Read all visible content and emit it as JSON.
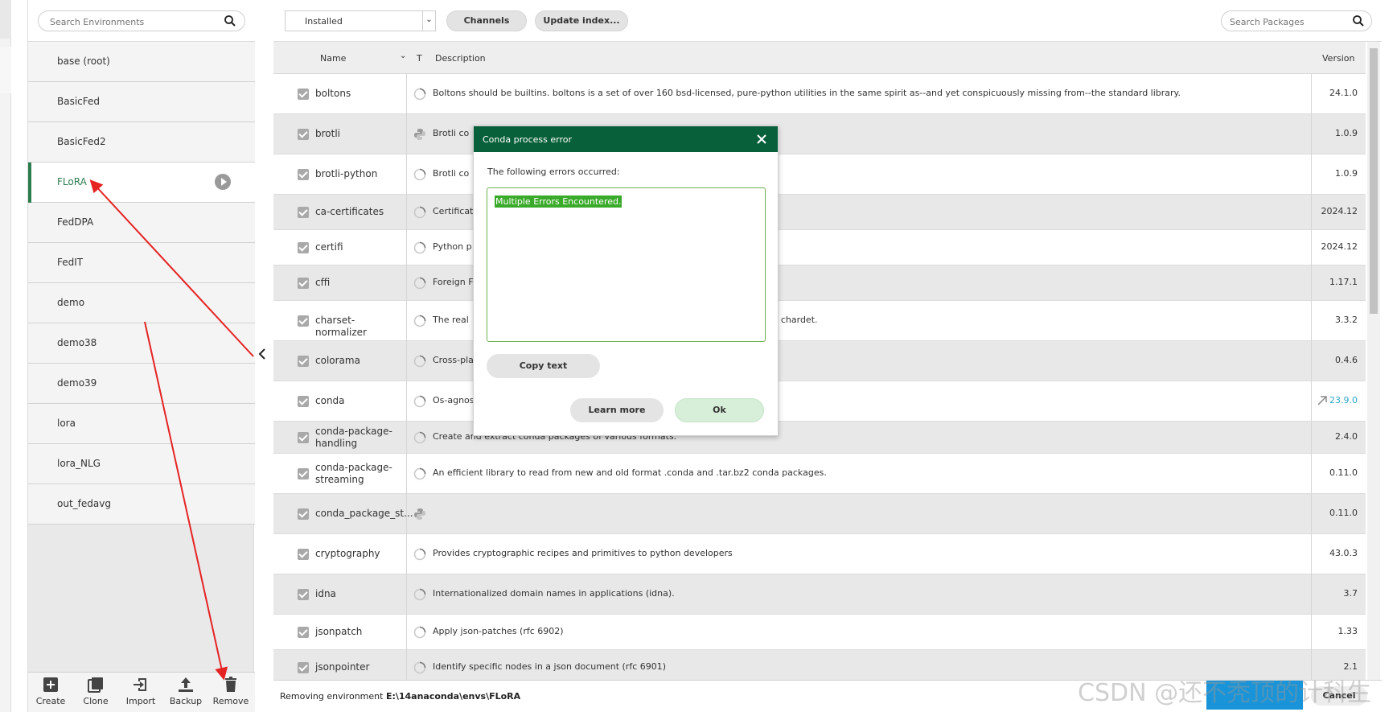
{
  "environments": {
    "search_placeholder": "Search Environments",
    "items": [
      {
        "label": "base (root)",
        "active": false
      },
      {
        "label": "BasicFed",
        "active": false
      },
      {
        "label": "BasicFed2",
        "active": false
      },
      {
        "label": "FLoRA",
        "active": true
      },
      {
        "label": "FedDPA",
        "active": false
      },
      {
        "label": "FedIT",
        "active": false
      },
      {
        "label": "demo",
        "active": false
      },
      {
        "label": "demo38",
        "active": false
      },
      {
        "label": "demo39",
        "active": false
      },
      {
        "label": "lora",
        "active": false
      },
      {
        "label": "lora_NLG",
        "active": false
      },
      {
        "label": "out_fedavg",
        "active": false
      }
    ],
    "toolbar": {
      "create": "Create",
      "clone": "Clone",
      "import": "Import",
      "backup": "Backup",
      "remove": "Remove"
    }
  },
  "packages": {
    "filter_value": "Installed",
    "channels_label": "Channels",
    "update_index_label": "Update index...",
    "search_placeholder": "Search Packages",
    "columns": {
      "name": "Name",
      "type": "T",
      "description": "Description",
      "version": "Version"
    },
    "rows": [
      {
        "name": "boltons",
        "description": "Boltons should be builtins. boltons is a set of over 160 bsd-licensed, pure-python utilities in the same spirit as--and yet conspicuously missing from--the standard library.",
        "version": "24.1.0",
        "status": "spinner",
        "updatable": false
      },
      {
        "name": "brotli",
        "description": "Brotli co",
        "version": "1.0.9",
        "status": "python",
        "updatable": false
      },
      {
        "name": "brotli-python",
        "description": "Brotli co",
        "version": "1.0.9",
        "status": "spinner",
        "updatable": false
      },
      {
        "name": "ca-certificates",
        "description": "Certificat",
        "version": "2024.12",
        "status": "spinner",
        "updatable": false
      },
      {
        "name": "certifi",
        "description": "Python p",
        "version": "2024.12",
        "status": "spinner",
        "updatable": false
      },
      {
        "name": "cffi",
        "description": "Foreign F",
        "version": "1.17.1",
        "status": "spinner",
        "updatable": false
      },
      {
        "name": "charset-normalizer",
        "description": "The real",
        "description_tail": "ed alternative to chardet.",
        "version": "3.3.2",
        "status": "spinner",
        "updatable": false
      },
      {
        "name": "colorama",
        "description": "Cross-pla",
        "version": "0.4.6",
        "status": "spinner",
        "updatable": false
      },
      {
        "name": "conda",
        "description": "Os-agnos",
        "version": "23.9.0",
        "status": "spinner",
        "updatable": true
      },
      {
        "name": "conda-package-handling",
        "description": "Create and extract conda packages of various formats.",
        "version": "2.4.0",
        "status": "spinner",
        "updatable": false
      },
      {
        "name": "conda-package-streaming",
        "description": "An efficient library to read from new and old format .conda and .tar.bz2 conda packages.",
        "version": "0.11.0",
        "status": "spinner",
        "updatable": false
      },
      {
        "name": "conda_package_st...",
        "description": "",
        "version": "0.11.0",
        "status": "python",
        "updatable": false
      },
      {
        "name": "cryptography",
        "description": "Provides cryptographic recipes and primitives to python developers",
        "version": "43.0.3",
        "status": "spinner",
        "updatable": false
      },
      {
        "name": "idna",
        "description": "Internationalized domain names in applications (idna).",
        "version": "3.7",
        "status": "spinner",
        "updatable": false
      },
      {
        "name": "jsonpatch",
        "description": "Apply json-patches (rfc 6902)",
        "version": "1.33",
        "status": "spinner",
        "updatable": false
      },
      {
        "name": "jsonpointer",
        "description": "Identify specific nodes in a json document (rfc 6901)",
        "version": "2.1",
        "status": "spinner",
        "updatable": false
      }
    ]
  },
  "status_bar": {
    "prefix": "Removing environment ",
    "path": "E:\\14anaconda\\envs\\FLoRA",
    "cancel_label": "Cancel"
  },
  "dialog": {
    "title": "Conda process error",
    "message": "The following errors occurred:",
    "error_text": "Multiple Errors Encountered.",
    "copy_label": "Copy text",
    "learn_label": "Learn more",
    "ok_label": "Ok"
  },
  "watermark": "CSDN @还不秃顶的计科生",
  "colors": {
    "brand_green": "#08603a",
    "active_green": "#2e7d4f",
    "update_blue": "#2fa6c8",
    "annotation_red": "#e52323",
    "progress_blue": "#1a94d8"
  }
}
